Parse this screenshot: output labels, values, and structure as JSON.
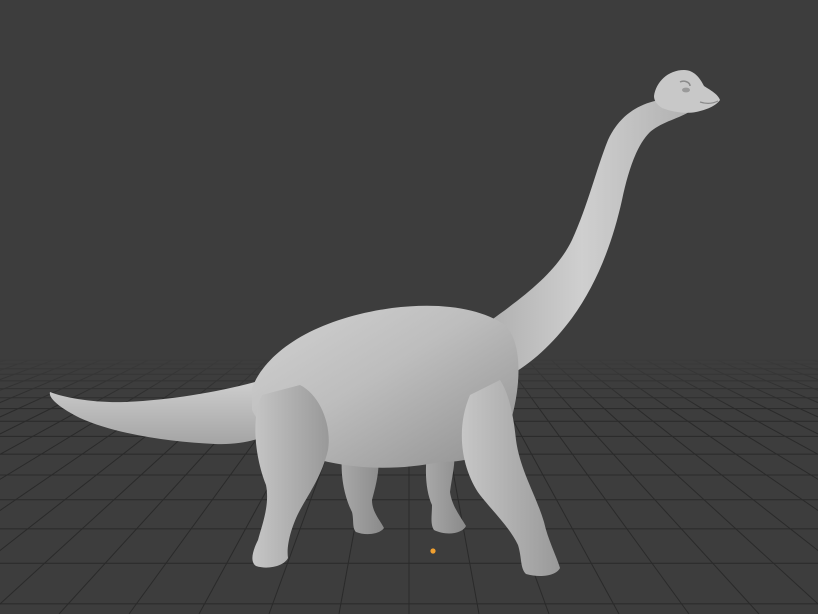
{
  "viewport": {
    "background_color": "#3d3d3d",
    "grid_color": "#2a2a2a",
    "model_color": "#b5b5b5",
    "origin_color": "#f0a030"
  },
  "scene": {
    "model_icon": "brachiosaurus-mesh",
    "origin_icon": "object-origin-dot"
  }
}
